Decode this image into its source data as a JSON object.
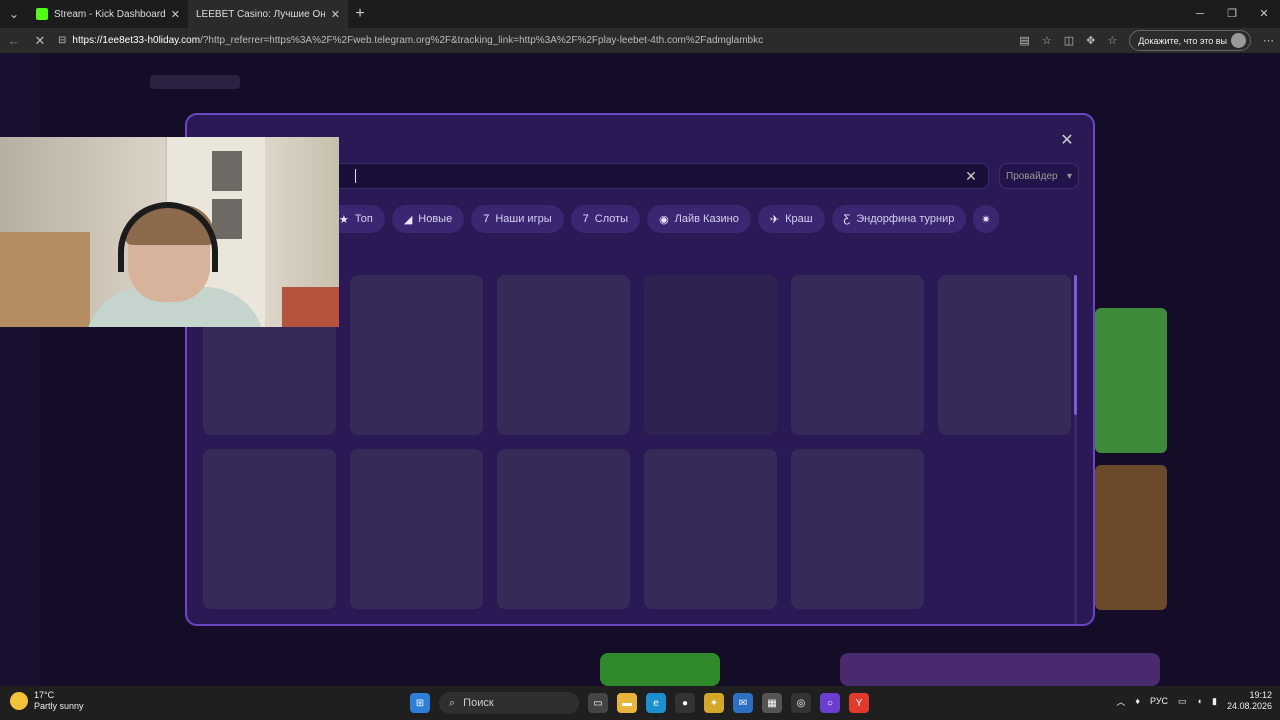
{
  "browser": {
    "tabs": [
      {
        "title": "Stream - Kick Dashboard",
        "favicon_color": "#53fc18"
      },
      {
        "title": "LEEBET Casino: Лучшие Онлайн И",
        "favicon_color": "#2b2b2b"
      }
    ],
    "url_domain": "https://1ee8et33-h0liday.com",
    "url_rest": "/?http_referrer=https%3A%2F%2Fweb.telegram.org%2F&tracking_link=http%3A%2F%2Fplay-leebet-4th.com%2Fadmglambkc",
    "proof_button": "Докажите, что это вы"
  },
  "modal": {
    "search": {
      "value": "",
      "placeholder": ""
    },
    "provider_label": "Провайдер",
    "chips": [
      {
        "icon": "star-icon",
        "glyph": "★",
        "label": "Топ"
      },
      {
        "icon": "megaphone-icon",
        "glyph": "◢",
        "label": "Новые"
      },
      {
        "icon": "slot-icon",
        "glyph": "7",
        "label": "Наши игры"
      },
      {
        "icon": "slot-icon",
        "glyph": "7",
        "label": "Слоты"
      },
      {
        "icon": "live-icon",
        "glyph": "◉",
        "label": "Лайв Казино"
      },
      {
        "icon": "plane-icon",
        "glyph": "✈",
        "label": "Краш"
      },
      {
        "icon": "endorphina-icon",
        "glyph": "Ƹ",
        "label": "Эндорфина турнир"
      },
      {
        "icon": "sparkle-icon",
        "glyph": "✷",
        "label": ""
      }
    ]
  },
  "taskbar": {
    "weather_temp": "17°C",
    "weather_desc": "Partly sunny",
    "search_label": "Поиск",
    "lang": "РУС",
    "time": "19:12",
    "date": "24.08.2026"
  },
  "colors": {
    "modal_bg": "#2a1955",
    "modal_border": "#6a46c4",
    "chip_bg": "#3b2771",
    "card_placeholder": "#362a58"
  }
}
